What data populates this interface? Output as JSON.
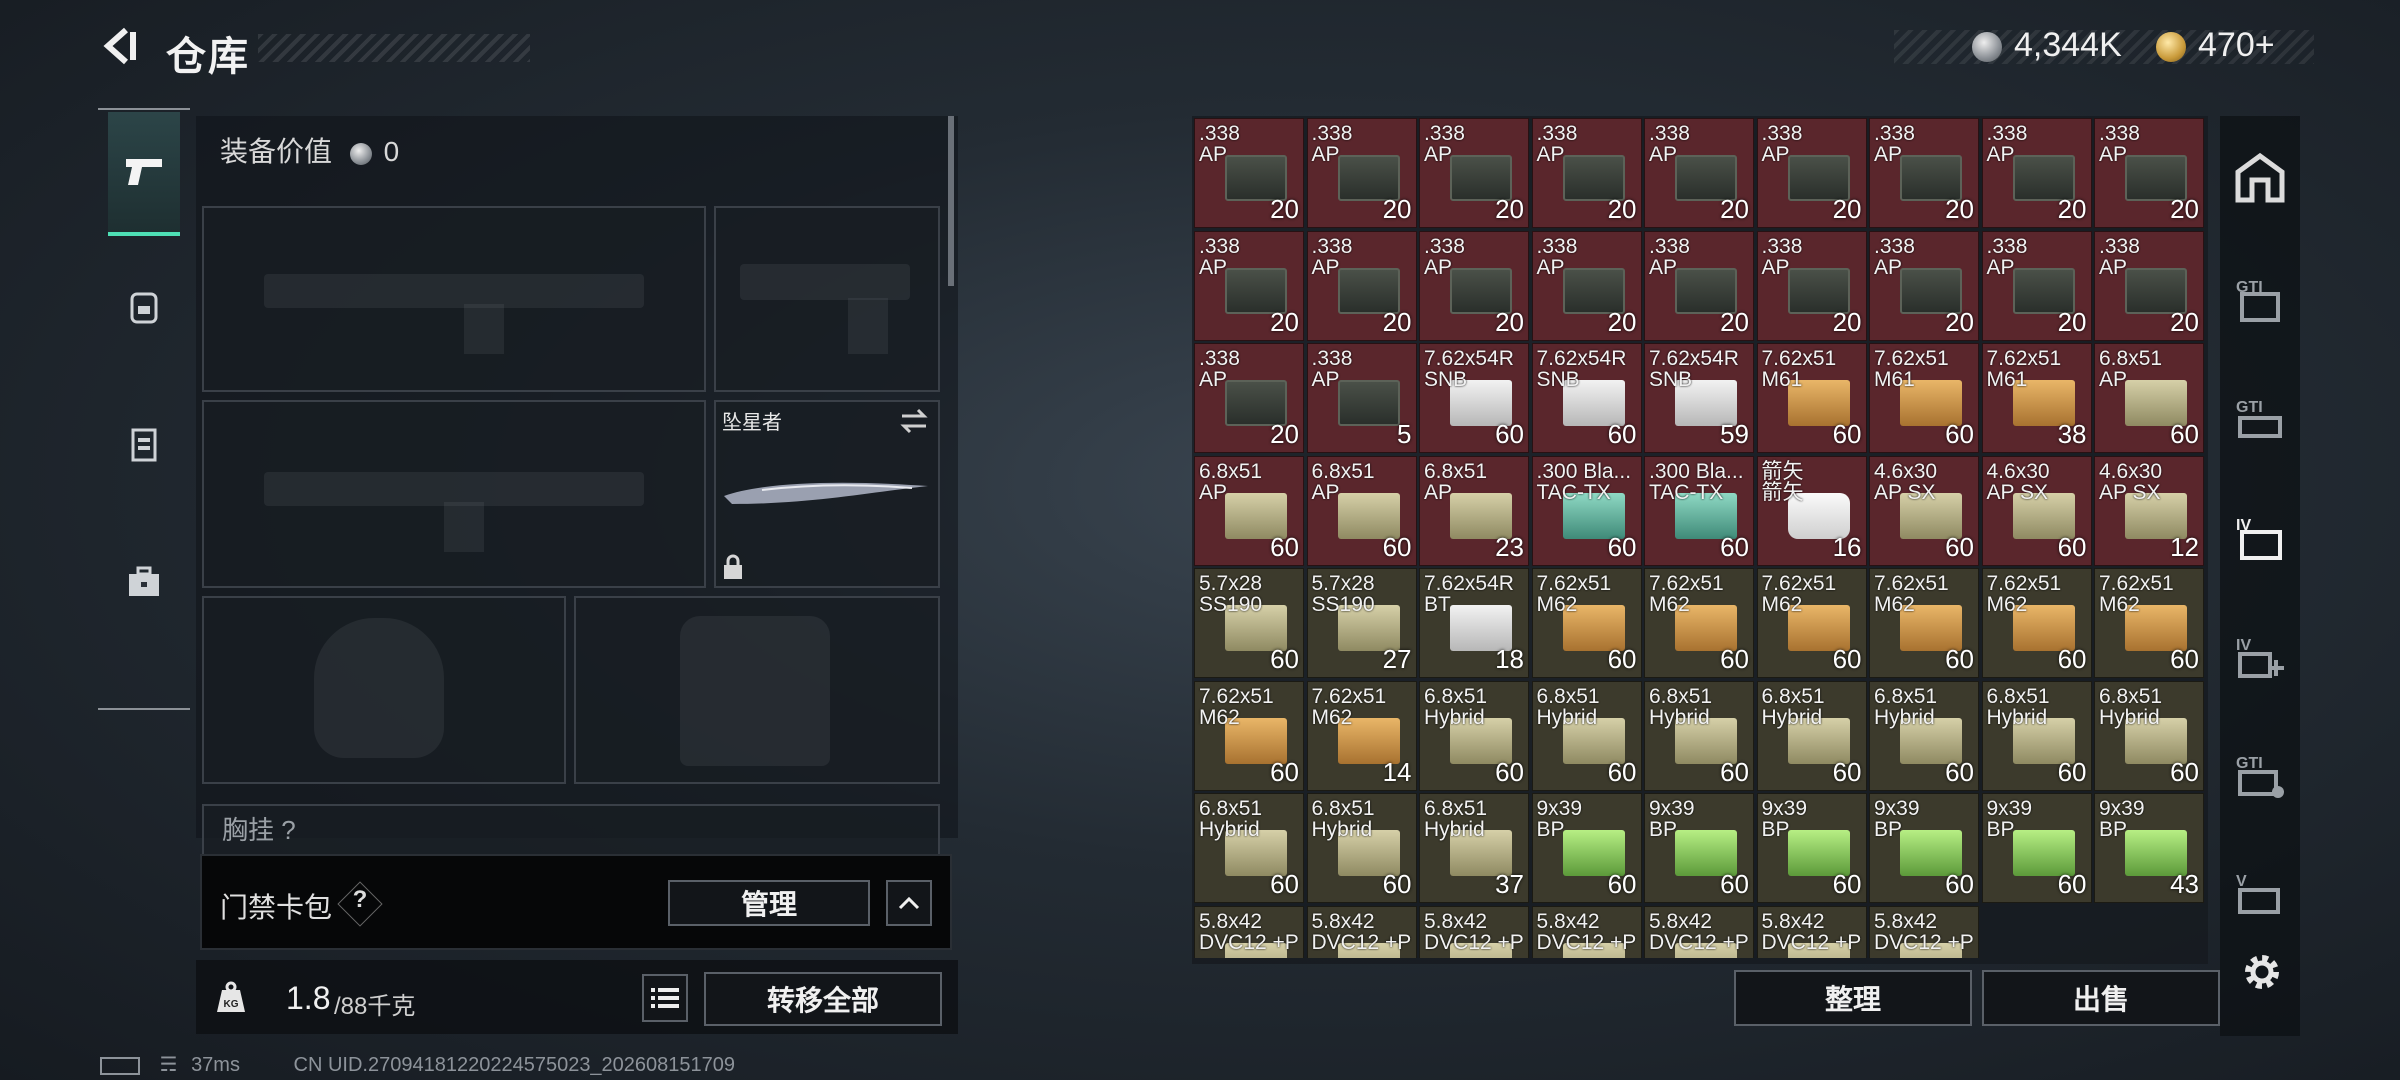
{
  "header": {
    "title": "仓库",
    "silver": "4,344K",
    "gold": "470+"
  },
  "equipment": {
    "value_label": "装备价值",
    "value": "0",
    "melee_name": "坠星者",
    "chest_label": "胸挂 ?",
    "keycard_label": "门禁卡包",
    "help": "?",
    "manage": "管理",
    "weight_current": "1.8",
    "weight_max": "/88千克",
    "transfer_all": "转移全部"
  },
  "status": {
    "ping": "37ms",
    "uid": "CN UID.27094181220224575023_202608151709"
  },
  "inventory": {
    "items": [
      {
        "name": ".338\nAP",
        "qty": "20",
        "style": "can",
        "red": true
      },
      {
        "name": ".338\nAP",
        "qty": "20",
        "style": "can",
        "red": true
      },
      {
        "name": ".338\nAP",
        "qty": "20",
        "style": "can",
        "red": true
      },
      {
        "name": ".338\nAP",
        "qty": "20",
        "style": "can",
        "red": true
      },
      {
        "name": ".338\nAP",
        "qty": "20",
        "style": "can",
        "red": true
      },
      {
        "name": ".338\nAP",
        "qty": "20",
        "style": "can",
        "red": true
      },
      {
        "name": ".338\nAP",
        "qty": "20",
        "style": "can",
        "red": true
      },
      {
        "name": ".338\nAP",
        "qty": "20",
        "style": "can",
        "red": true
      },
      {
        "name": ".338\nAP",
        "qty": "20",
        "style": "can",
        "red": true
      },
      {
        "name": ".338\nAP",
        "qty": "20",
        "style": "can",
        "red": true
      },
      {
        "name": ".338\nAP",
        "qty": "20",
        "style": "can",
        "red": true
      },
      {
        "name": ".338\nAP",
        "qty": "20",
        "style": "can",
        "red": true
      },
      {
        "name": ".338\nAP",
        "qty": "20",
        "style": "can",
        "red": true
      },
      {
        "name": ".338\nAP",
        "qty": "20",
        "style": "can",
        "red": true
      },
      {
        "name": ".338\nAP",
        "qty": "20",
        "style": "can",
        "red": true
      },
      {
        "name": ".338\nAP",
        "qty": "20",
        "style": "can",
        "red": true
      },
      {
        "name": ".338\nAP",
        "qty": "20",
        "style": "can",
        "red": true
      },
      {
        "name": ".338\nAP",
        "qty": "20",
        "style": "can",
        "red": true
      },
      {
        "name": ".338\nAP",
        "qty": "20",
        "style": "can",
        "red": true
      },
      {
        "name": ".338\nAP",
        "qty": "5",
        "style": "can",
        "red": true
      },
      {
        "name": "7.62x54R\nSNB",
        "qty": "60",
        "style": "white",
        "red": true
      },
      {
        "name": "7.62x54R\nSNB",
        "qty": "60",
        "style": "white",
        "red": true
      },
      {
        "name": "7.62x54R\nSNB",
        "qty": "59",
        "style": "white",
        "red": true
      },
      {
        "name": "7.62x51\nM61",
        "qty": "60",
        "style": "tan",
        "red": true
      },
      {
        "name": "7.62x51\nM61",
        "qty": "60",
        "style": "tan",
        "red": true
      },
      {
        "name": "7.62x51\nM61",
        "qty": "38",
        "style": "tan",
        "red": true
      },
      {
        "name": "6.8x51\nAP",
        "qty": "60",
        "style": "olive",
        "red": true
      },
      {
        "name": "6.8x51\nAP",
        "qty": "60",
        "style": "olive",
        "red": true
      },
      {
        "name": "6.8x51\nAP",
        "qty": "60",
        "style": "olive",
        "red": true
      },
      {
        "name": "6.8x51\nAP",
        "qty": "23",
        "style": "olive",
        "red": true
      },
      {
        "name": ".300 Bla...\nTAC-TX",
        "qty": "60",
        "style": "teal",
        "red": true
      },
      {
        "name": ".300 Bla...\nTAC-TX",
        "qty": "60",
        "style": "teal",
        "red": true
      },
      {
        "name": "箭矢\n箭矢",
        "qty": "16",
        "style": "pale",
        "red": true
      },
      {
        "name": "4.6x30\nAP SX",
        "qty": "60",
        "style": "olive",
        "red": true
      },
      {
        "name": "4.6x30\nAP SX",
        "qty": "60",
        "style": "olive",
        "red": true
      },
      {
        "name": "4.6x30\nAP SX",
        "qty": "12",
        "style": "olive",
        "red": true
      },
      {
        "name": "5.7x28\nSS190",
        "qty": "60",
        "style": "olive",
        "red": false
      },
      {
        "name": "5.7x28\nSS190",
        "qty": "27",
        "style": "olive",
        "red": false
      },
      {
        "name": "7.62x54R\nBT",
        "qty": "18",
        "style": "white",
        "red": false
      },
      {
        "name": "7.62x51\nM62",
        "qty": "60",
        "style": "tan",
        "red": false
      },
      {
        "name": "7.62x51\nM62",
        "qty": "60",
        "style": "tan",
        "red": false
      },
      {
        "name": "7.62x51\nM62",
        "qty": "60",
        "style": "tan",
        "red": false
      },
      {
        "name": "7.62x51\nM62",
        "qty": "60",
        "style": "tan",
        "red": false
      },
      {
        "name": "7.62x51\nM62",
        "qty": "60",
        "style": "tan",
        "red": false
      },
      {
        "name": "7.62x51\nM62",
        "qty": "60",
        "style": "tan",
        "red": false
      },
      {
        "name": "7.62x51\nM62",
        "qty": "60",
        "style": "tan",
        "red": false
      },
      {
        "name": "7.62x51\nM62",
        "qty": "14",
        "style": "tan",
        "red": false
      },
      {
        "name": "6.8x51\nHybrid",
        "qty": "60",
        "style": "olive",
        "red": false
      },
      {
        "name": "6.8x51\nHybrid",
        "qty": "60",
        "style": "olive",
        "red": false
      },
      {
        "name": "6.8x51\nHybrid",
        "qty": "60",
        "style": "olive",
        "red": false
      },
      {
        "name": "6.8x51\nHybrid",
        "qty": "60",
        "style": "olive",
        "red": false
      },
      {
        "name": "6.8x51\nHybrid",
        "qty": "60",
        "style": "olive",
        "red": false
      },
      {
        "name": "6.8x51\nHybrid",
        "qty": "60",
        "style": "olive",
        "red": false
      },
      {
        "name": "6.8x51\nHybrid",
        "qty": "60",
        "style": "olive",
        "red": false
      },
      {
        "name": "6.8x51\nHybrid",
        "qty": "60",
        "style": "olive",
        "red": false
      },
      {
        "name": "6.8x51\nHybrid",
        "qty": "60",
        "style": "olive",
        "red": false
      },
      {
        "name": "6.8x51\nHybrid",
        "qty": "37",
        "style": "olive",
        "red": false
      },
      {
        "name": "9x39\nBP",
        "qty": "60",
        "style": "green",
        "red": false
      },
      {
        "name": "9x39\nBP",
        "qty": "60",
        "style": "green",
        "red": false
      },
      {
        "name": "9x39\nBP",
        "qty": "60",
        "style": "green",
        "red": false
      },
      {
        "name": "9x39\nBP",
        "qty": "60",
        "style": "green",
        "red": false
      },
      {
        "name": "9x39\nBP",
        "qty": "60",
        "style": "green",
        "red": false
      },
      {
        "name": "9x39\nBP",
        "qty": "43",
        "style": "green",
        "red": false
      },
      {
        "name": "5.8x42\nDVC12 +P",
        "qty": "",
        "style": "olive",
        "red": false
      },
      {
        "name": "5.8x42\nDVC12 +P",
        "qty": "",
        "style": "olive",
        "red": false
      },
      {
        "name": "5.8x42\nDVC12 +P",
        "qty": "",
        "style": "olive",
        "red": false
      },
      {
        "name": "5.8x42\nDVC12 +P",
        "qty": "",
        "style": "olive",
        "red": false
      },
      {
        "name": "5.8x42\nDVC12 +P",
        "qty": "",
        "style": "olive",
        "red": false
      },
      {
        "name": "5.8x42\nDVC12 +P",
        "qty": "",
        "style": "olive",
        "red": false
      },
      {
        "name": "5.8x42\nDVC12 +P",
        "qty": "",
        "style": "olive",
        "red": false
      }
    ],
    "sort": "整理",
    "sell": "出售"
  },
  "colors": {
    "red_cell": "#5a262c",
    "olive_cell": "#3c3a2c",
    "accent": "#4ee0b5"
  }
}
